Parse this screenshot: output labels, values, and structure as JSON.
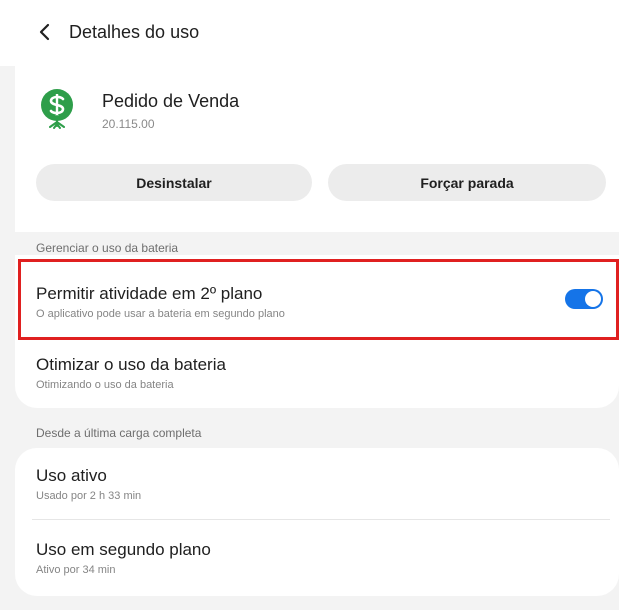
{
  "header": {
    "back_icon": "chevron-left-icon",
    "title": "Detalhes do uso"
  },
  "app": {
    "icon": "dollar-tree-app-icon",
    "name": "Pedido de Venda",
    "version": "20.115.00",
    "brand_color": "#2e9e4a"
  },
  "buttons": {
    "uninstall": "Desinstalar",
    "force_stop": "Forçar parada"
  },
  "battery_section": {
    "header": "Gerenciar o uso da bateria",
    "background_activity": {
      "title": "Permitir atividade em 2º plano",
      "subtitle": "O aplicativo pode usar a bateria em segundo plano",
      "toggle_on": true,
      "toggle_color": "#1574e8"
    },
    "optimize": {
      "title": "Otimizar o uso da bateria",
      "subtitle": "Otimizando o uso da bateria"
    }
  },
  "usage_section": {
    "header": "Desde a última carga completa",
    "active_use": {
      "title": "Uso ativo",
      "subtitle": "Usado por 2 h 33 min"
    },
    "background_use": {
      "title": "Uso em segundo plano",
      "subtitle": "Ativo por 34 min"
    }
  },
  "highlight_color": "#e02020"
}
